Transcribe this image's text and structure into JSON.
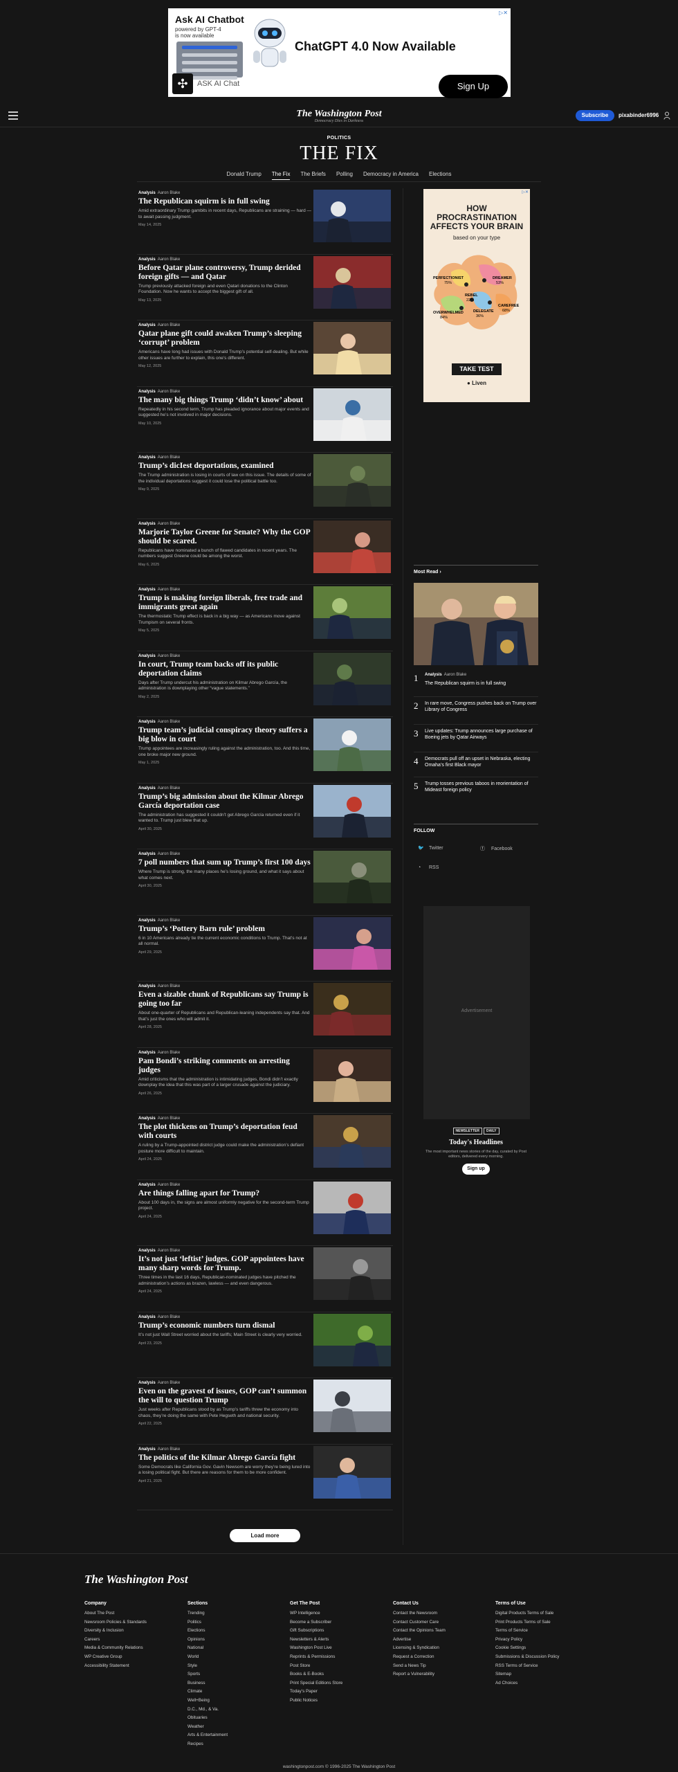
{
  "top_ad": {
    "adchoice": "▷✕",
    "brand": "Ask AI Chatbot",
    "brand_sub_1": "powered by GPT-4",
    "brand_sub_2": "is now available",
    "headline": "ChatGPT 4.0 Now Available",
    "app_name": "ASK AI Chat",
    "cta": "Sign Up"
  },
  "header": {
    "logo": "The Washington Post",
    "tagline": "Democracy Dies in Darkness",
    "subscribe": "Subscribe",
    "username": "pixabinder6996"
  },
  "section": {
    "kicker": "POLITICS",
    "title": "THE FIX",
    "nav": [
      "Donald Trump",
      "The Fix",
      "The Briefs",
      "Polling",
      "Democracy in America",
      "Elections"
    ],
    "active_nav": "The Fix"
  },
  "articles": [
    {
      "label": "Analysis",
      "author": "Aaron Blake",
      "title": "The Republican squirm is in full swing",
      "blurb": "Amid extraordinary Trump gambits in recent days, Republicans are straining — hard — to await passing judgment.",
      "date": "May 14, 2025"
    },
    {
      "label": "Analysis",
      "author": "Aaron Blake",
      "title": "Before Qatar plane controversy, Trump derided foreign gifts — and Qatar",
      "blurb": "Trump previously attacked foreign and even Qatari donations to the Clinton Foundation. Now he wants to accept the biggest gift of all.",
      "date": "May 13, 2025"
    },
    {
      "label": "Analysis",
      "author": "Aaron Blake",
      "title": "Qatar plane gift could awaken Trump’s sleeping ‘corrupt’ problem",
      "blurb": "Americans have long had issues with Donald Trump’s potential self-dealing. But while other issues are further to explain, this one’s different.",
      "date": "May 12, 2025"
    },
    {
      "label": "Analysis",
      "author": "Aaron Blake",
      "title": "The many big things Trump ‘didn’t know’ about",
      "blurb": "Repeatedly in his second term, Trump has pleaded ignorance about major events and suggested he’s not involved in major decisions.",
      "date": "May 10, 2025"
    },
    {
      "label": "Analysis",
      "author": "Aaron Blake",
      "title": "Trump’s dicIest deportations, examined",
      "blurb": "The Trump administration is losing in courts of law on this issue. The details of some of the individual deportations suggest it could lose the political battle too.",
      "date": "May 9, 2025"
    },
    {
      "label": "Analysis",
      "author": "Aaron Blake",
      "title": "Marjorie Taylor Greene for Senate? Why the GOP should be scared.",
      "blurb": "Republicans have nominated a bunch of flawed candidates in recent years. The numbers suggest Greene could be among the worst.",
      "date": "May 6, 2025"
    },
    {
      "label": "Analysis",
      "author": "Aaron Blake",
      "title": "Trump is making foreign liberals, free trade and immigrants great again",
      "blurb": "The thermostatic Trump effect is back in a big way — as Americans move against Trumpism on several fronts.",
      "date": "May 5, 2025"
    },
    {
      "label": "Analysis",
      "author": "Aaron Blake",
      "title": "In court, Trump team backs off its public deportation claims",
      "blurb": "Days after Trump undercut his administration on Kilmar Abrego García, the administration is downplaying other “vague statements.”",
      "date": "May 2, 2025"
    },
    {
      "label": "Analysis",
      "author": "Aaron Blake",
      "title": "Trump team’s judicial conspiracy theory suffers a big blow in court",
      "blurb": "Trump appointees are increasingly ruling against the administration, too. And this time, one broke major new ground.",
      "date": "May 1, 2025"
    },
    {
      "label": "Analysis",
      "author": "Aaron Blake",
      "title": "Trump’s big admission about the Kilmar Abrego García deportation case",
      "blurb": "The administration has suggested it couldn’t get Abrego García returned even if it wanted to. Trump just blew that up.",
      "date": "April 30, 2025"
    },
    {
      "label": "Analysis",
      "author": "Aaron Blake",
      "title": "7 poll numbers that sum up Trump’s first 100 days",
      "blurb": "Where Trump is strong, the many places he’s losing ground, and what it says about what comes next.",
      "date": "April 30, 2025"
    },
    {
      "label": "Analysis",
      "author": "Aaron Blake",
      "title": "Trump’s ‘Pottery Barn rule’ problem",
      "blurb": "6 in 10 Americans already tie the current economic conditions to Trump. That’s not at all normal.",
      "date": "April 29, 2025"
    },
    {
      "label": "Analysis",
      "author": "Aaron Blake",
      "title": "Even a sizable chunk of Republicans say Trump is going too far",
      "blurb": "About one-quarter of Republicans and Republican-leaning independents say that. And that’s just the ones who will admit it.",
      "date": "April 28, 2025"
    },
    {
      "label": "Analysis",
      "author": "Aaron Blake",
      "title": "Pam Bondi’s striking comments on arresting judges",
      "blurb": "Amid criticisms that the administration is intimidating judges, Bondi didn’t exactly downplay the idea that this was part of a larger crusade against the judiciary.",
      "date": "April 26, 2025"
    },
    {
      "label": "Analysis",
      "author": "Aaron Blake",
      "title": "The plot thickens on Trump’s deportation feud with courts",
      "blurb": "A ruling by a Trump-appointed district judge could make the administration’s defiant posture more difficult to maintain.",
      "date": "April 24, 2025"
    },
    {
      "label": "Analysis",
      "author": "Aaron Blake",
      "title": "Are things falling apart for Trump?",
      "blurb": "About 100 days in, the signs are almost uniformly negative for the second-term Trump project.",
      "date": "April 24, 2025"
    },
    {
      "label": "Analysis",
      "author": "Aaron Blake",
      "title": "It’s not just ‘leftist’ judges. GOP appointees have many sharp words for Trump.",
      "blurb": "Three times in the last 16 days, Republican-nominated judges have pitched the administration’s actions as brazen, lawless — and even dangerous.",
      "date": "April 24, 2025"
    },
    {
      "label": "Analysis",
      "author": "Aaron Blake",
      "title": "Trump’s economic numbers turn dismal",
      "blurb": "It’s not just Wall Street worried about the tariffs; Main Street is clearly very worried.",
      "date": "April 23, 2025"
    },
    {
      "label": "Analysis",
      "author": "Aaron Blake",
      "title": "Even on the gravest of issues, GOP can’t summon the will to question Trump",
      "blurb": "Just weeks after Republicans stood by as Trump’s tariffs threw the economy into chaos, they’re doing the same with Pete Hegseth and national security.",
      "date": "April 22, 2025"
    },
    {
      "label": "Analysis",
      "author": "Aaron Blake",
      "title": "The politics of the Kilmar Abrego García fight",
      "blurb": "Some Democrats like California Gov. Gavin Newsom are worry they’re being lured into a losing political fight. But there are reasons for them to be more confident.",
      "date": "April 21, 2025"
    }
  ],
  "load_more": "Load more",
  "rail_ad": {
    "adchoice": "▷✕",
    "headline_1": "HOW",
    "headline_2": "PROCRASTINATION",
    "headline_3": "AFFECTS YOUR BRAIN",
    "sub": "based on your type",
    "types": [
      {
        "name": "PERFECTIONIST",
        "pct": "75%"
      },
      {
        "name": "DREAMER",
        "pct": "53%"
      },
      {
        "name": "REBEL",
        "pct": "22%"
      },
      {
        "name": "OVERWHELMED",
        "pct": "84%"
      },
      {
        "name": "DELEGATE",
        "pct": "36%"
      },
      {
        "name": "CAREFREE",
        "pct": "68%"
      }
    ],
    "cta": "TAKE TEST",
    "brand": "Liven"
  },
  "most_read": {
    "heading": "Most Read",
    "items": [
      {
        "num": "1",
        "label": "Analysis",
        "author": "Aaron Blake",
        "title": "The Republican squirm is in full swing"
      },
      {
        "num": "2",
        "title": "In rare move, Congress pushes back on Trump over Library of Congress"
      },
      {
        "num": "3",
        "title": "Live updates: Trump announces large purchase of Boeing jets by Qatar Airways"
      },
      {
        "num": "4",
        "title": "Democrats pull off an upset in Nebraska, electing Omaha’s first Black mayor"
      },
      {
        "num": "5",
        "title": "Trump tosses previous taboos in reorientation of Mideast foreign policy"
      }
    ]
  },
  "follow": {
    "heading": "FOLLOW",
    "links": [
      "Twitter",
      "Facebook",
      "RSS"
    ]
  },
  "rail_ad2_label": "Advertisement",
  "newsletter": {
    "tag1": "NEWSLETTER",
    "tag2": "DAILY",
    "title": "Today's Headlines",
    "desc": "The most important news stories of the day, curated by Post editors, delivered every morning.",
    "cta": "Sign up"
  },
  "footer": {
    "logo": "The Washington Post",
    "columns": [
      {
        "heading": "Company",
        "items": [
          "About The Post",
          "Newsroom Policies & Standards",
          "Diversity & Inclusion",
          "Careers",
          "Media & Community Relations",
          "WP Creative Group",
          "Accessibility Statement"
        ]
      },
      {
        "heading": "Sections",
        "items": [
          "Trending",
          "Politics",
          "Elections",
          "Opinions",
          "National",
          "World",
          "Style",
          "Sports",
          "Business",
          "Climate",
          "Well+Being",
          "D.C., Md., & Va.",
          "Obituaries",
          "Weather",
          "Arts & Entertainment",
          "Recipes"
        ]
      },
      {
        "heading": "Get The Post",
        "items": [
          "WP Intelligence",
          "Become a Subscriber",
          "Gift Subscriptions",
          "Newsletters & Alerts",
          "Washington Post Live",
          "Reprints & Permissions",
          "Post Store",
          "Books & E-Books",
          "Print Special Editions Store",
          "Today’s Paper",
          "Public Notices"
        ]
      },
      {
        "heading": "Contact Us",
        "items": [
          "Contact the Newsroom",
          "Contact Customer Care",
          "Contact the Opinions Team",
          "Advertise",
          "Licensing & Syndication",
          "Request a Correction",
          "Send a News Tip",
          "Report a Vulnerability"
        ]
      },
      {
        "heading": "Terms of Use",
        "items": [
          "Digital Products Terms of Sale",
          "Print Products Terms of Sale",
          "Terms of Service",
          "Privacy Policy",
          "Cookie Settings",
          "Submissions & Discussion Policy",
          "RSS Terms of Service",
          "Sitemap",
          "Ad Choices"
        ]
      }
    ],
    "copyright": "washingtonpost.com © 1996-2025 The Washington Post"
  },
  "colors": {
    "background": "#161616",
    "accent_blue": "#1f5ad6"
  }
}
